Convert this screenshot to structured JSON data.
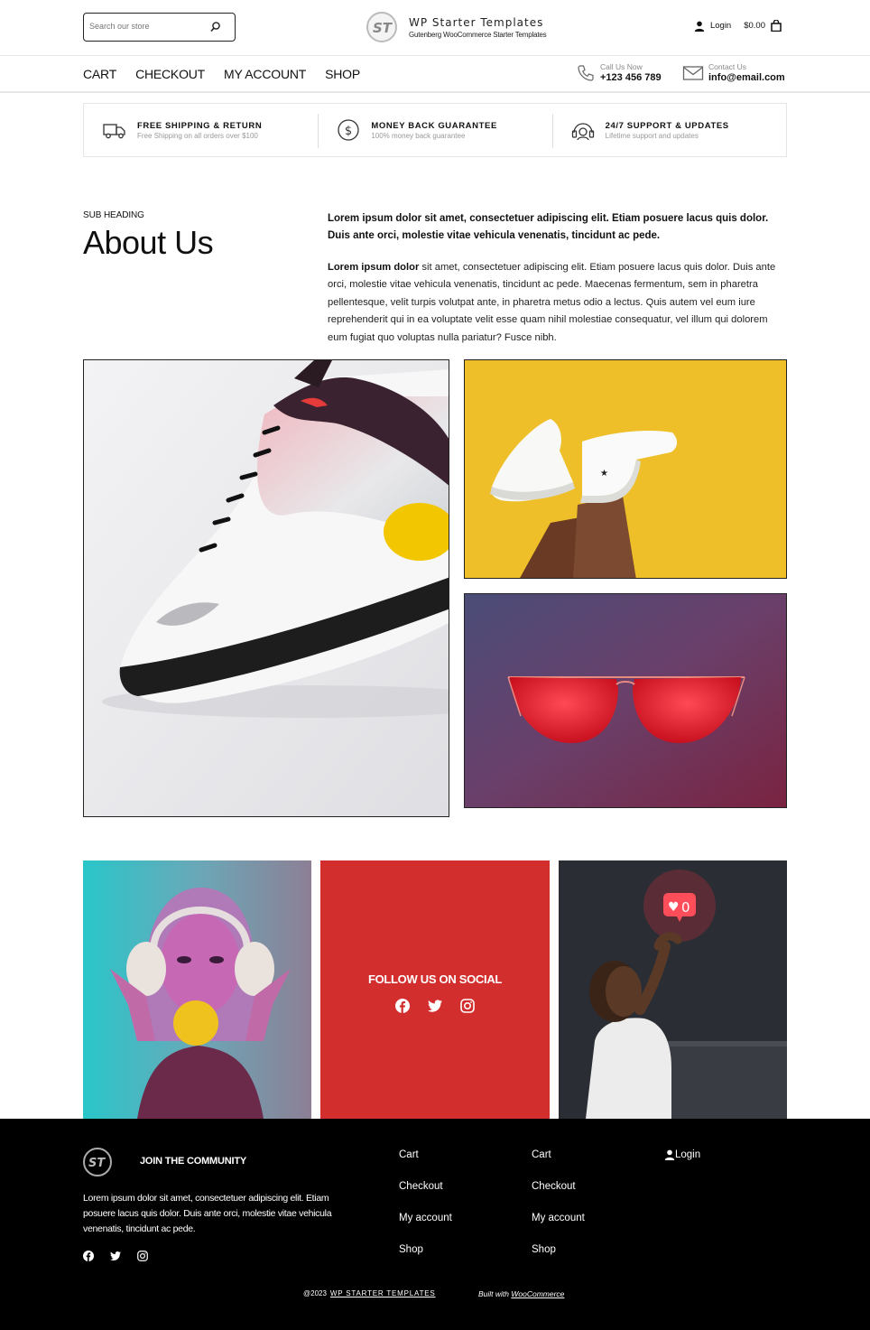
{
  "header": {
    "search_placeholder": "Search our store",
    "brand_title": "WP Starter Templates",
    "brand_subtitle": "Gutenberg WooCommerce Starter Templates",
    "login_label": "Login",
    "cart_total": "$0.00"
  },
  "nav": {
    "items": [
      "CART",
      "CHECKOUT",
      "MY ACCOUNT",
      "SHOP"
    ],
    "phone_label": "Call Us Now",
    "phone_value": "+123 456 789",
    "email_label": "Contact Us",
    "email_value": "info@email.com"
  },
  "features": [
    {
      "title": "FREE SHIPPING & RETURN",
      "subtitle": "Free Shipping on all orders over $100",
      "icon": "truck-icon"
    },
    {
      "title": "MONEY BACK GUARANTEE",
      "subtitle": "100% money back guarantee",
      "icon": "dollar-icon"
    },
    {
      "title": "24/7 SUPPORT & UPDATES",
      "subtitle": "Lifetime support and updates",
      "icon": "support-icon"
    }
  ],
  "about": {
    "subheading": "SUB HEADING",
    "title": "About Us",
    "lead": "Lorem ipsum dolor sit amet, consectetuer adipiscing elit. Etiam posuere lacus quis dolor. Duis ante orci, molestie vitae vehicula venenatis, tincidunt ac pede.",
    "body_bold": "Lorem ipsum dolor",
    "body_rest": " sit amet, consectetuer adipiscing elit. Etiam posuere lacus quis dolor. Duis ante orci, molestie vitae vehicula venenatis, tincidunt ac pede. Maecenas fermentum, sem in pharetra pellentesque, velit turpis volutpat ante, in pharetra metus odio a lectus. Quis autem vel eum iure reprehenderit qui in ea voluptate velit esse quam nihil molestiae consequatur, vel illum qui dolorem eum fugiat quo voluptas nulla pariatur? Fusce nibh."
  },
  "social": {
    "title": "FOLLOW US ON SOCIAL",
    "icons": [
      "facebook-icon",
      "twitter-icon",
      "instagram-icon"
    ],
    "like_count": "0",
    "accent": "#d22e2e"
  },
  "footer": {
    "join": "JOIN THE COMMUNITY",
    "description": "Lorem ipsum dolor sit amet, consectetuer adipiscing elit. Etiam posuere lacus quis dolor. Duis ante orci, molestie vitae vehicula venenatis, tincidunt ac pede.",
    "col1": [
      "Cart",
      "Checkout",
      "My account",
      "Shop"
    ],
    "col2": [
      "Cart",
      "Checkout",
      "My account",
      "Shop"
    ],
    "login": "Login",
    "copyright_prefix": "@2023",
    "copyright_brand": "WP STARTER TEMPLATES",
    "built_prefix": "Built with ",
    "built_link": "WooCommerce"
  }
}
